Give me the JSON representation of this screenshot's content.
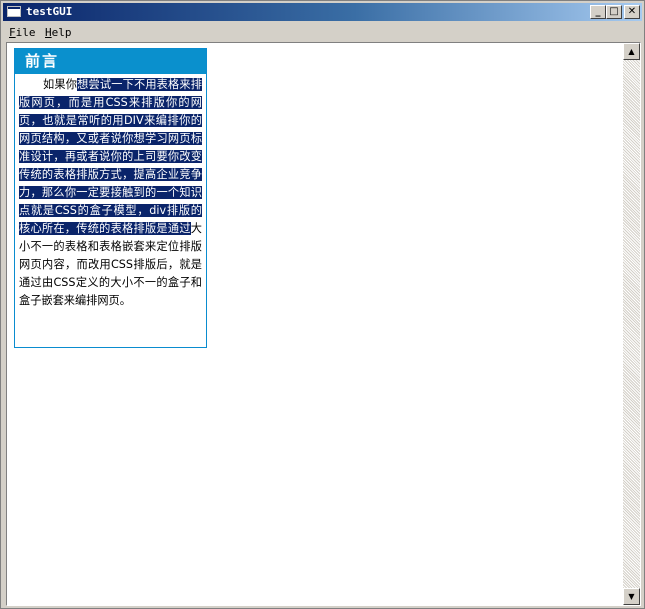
{
  "window": {
    "title": "testGUI"
  },
  "titlebar": {
    "minimize": "_",
    "maximize": "□",
    "close": "✕"
  },
  "menu": {
    "file": {
      "hotkey": "F",
      "rest": "ile"
    },
    "help": {
      "hotkey": "H",
      "rest": "elp"
    }
  },
  "panel": {
    "title": "前言",
    "text_before": "如果你",
    "text_selected": "想尝试一下不用表格来排版网页，而是用CSS来排版你的网页，也就是常听的用DIV来编排你的网页结构，又或者说你想学习网页标准设计，再或者说你的上司要你改变传统的表格排版方式，提高企业竞争力，那么你一定要接触到的一个知识点就是CSS的盒子模型，div排版的核心所在，传统的表格排版是通过",
    "text_after": "大小不一的表格和表格嵌套来定位排版网页内容，而改用CSS排版后，就是通过由CSS定义的大小不一的盒子和盒子嵌套来编排网页。"
  },
  "scrollbar": {
    "up": "▲",
    "down": "▼"
  },
  "colors": {
    "selection": "#0a246a",
    "panel_header": "#0a90cd"
  }
}
